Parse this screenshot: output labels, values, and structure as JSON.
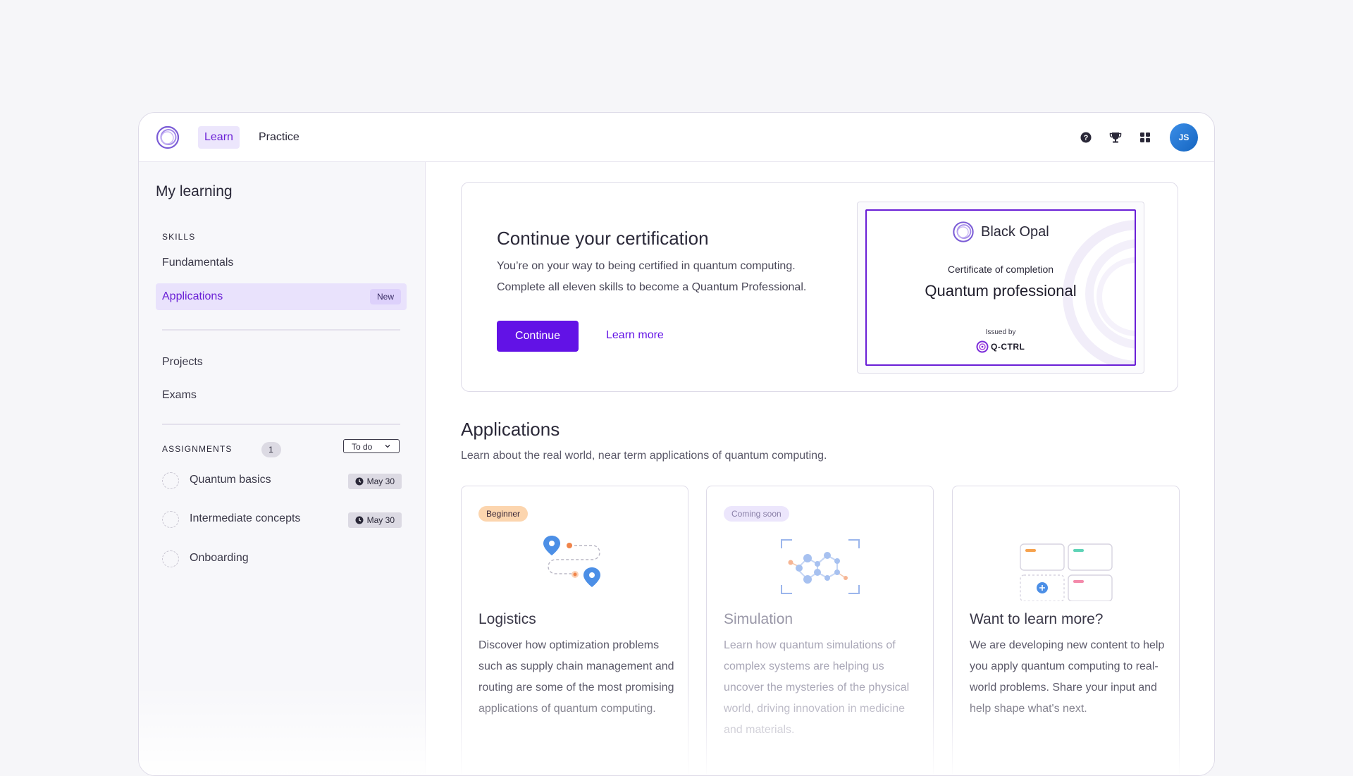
{
  "nav": {
    "tabs": [
      {
        "label": "Learn",
        "active": true
      },
      {
        "label": "Practice",
        "active": false
      }
    ],
    "icons": [
      "help-icon",
      "trophy-icon",
      "apps-grid-icon"
    ],
    "avatar_initials": "JS"
  },
  "sidebar": {
    "title": "My learning",
    "skills_heading": "SKILLS",
    "skills": [
      {
        "label": "Fundamentals"
      },
      {
        "label": "Applications",
        "badge": "New",
        "active": true
      }
    ],
    "extras": [
      {
        "label": "Projects"
      },
      {
        "label": "Exams"
      }
    ],
    "assignments_heading": "ASSIGNMENTS",
    "assignments_count": "1",
    "filter_value": "To do",
    "assignments": [
      {
        "label": "Quantum basics",
        "due": "May 30"
      },
      {
        "label": "Intermediate concepts",
        "due": "May 30"
      },
      {
        "label": "Onboarding",
        "due": ""
      }
    ]
  },
  "certification": {
    "title": "Continue your certification",
    "desc_line1": "You’re on your way to being certified in quantum computing.",
    "desc_line2": "Complete all eleven skills to become a Quantum Professional.",
    "continue_label": "Continue",
    "learn_more_label": "Learn more",
    "certificate": {
      "brand": "Black Opal",
      "subtitle": "Certificate of completion",
      "name": "Quantum professional",
      "issued_by_label": "Issued by",
      "issuer": "Q-CTRL"
    }
  },
  "applications": {
    "title": "Applications",
    "description": "Learn about the real world, near term applications of quantum computing.",
    "cards": [
      {
        "tag": "Beginner",
        "name": "Logistics",
        "desc": "Discover how optimization problems such as supply chain management and routing are some of the most promising applications of quantum computing."
      },
      {
        "tag": "Coming soon",
        "name": "Simulation",
        "desc": "Learn how quantum simulations of complex systems are helping us uncover the mysteries of the physical world, driving innovation in medicine and materials."
      },
      {
        "tag": "",
        "name": "Want to learn more?",
        "desc": "We are developing new content to help you apply quantum computing to real-world problems. Share your input and help shape what's next."
      }
    ]
  },
  "colors": {
    "accent": "#6212e6",
    "accent_light": "#ece6fc",
    "beginner_tag": "#fcd5ae"
  }
}
